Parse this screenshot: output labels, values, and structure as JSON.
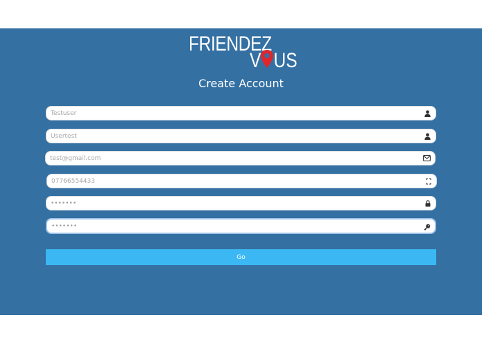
{
  "logo": {
    "line1": "FRIENDEZ",
    "line2_left": "V",
    "line2_right": "US"
  },
  "form": {
    "title": "Create Account",
    "fields": [
      {
        "value": "",
        "placeholder": "Testuser",
        "icon": "user-icon"
      },
      {
        "value": "",
        "placeholder": "Usertest",
        "icon": "user-icon"
      },
      {
        "value": "",
        "placeholder": "test@gmail.com",
        "icon": "envelope-icon"
      },
      {
        "value": "",
        "placeholder": "07766554433",
        "icon": "phone-icon"
      },
      {
        "value": "•••••••",
        "placeholder": "",
        "icon": "lock-icon"
      },
      {
        "value": "•••••••",
        "placeholder": "",
        "icon": "key-icon"
      }
    ],
    "submit_label": "Go"
  },
  "colors": {
    "background": "#3470a2",
    "button": "#3bb8f3",
    "pin": "#e0262c"
  }
}
